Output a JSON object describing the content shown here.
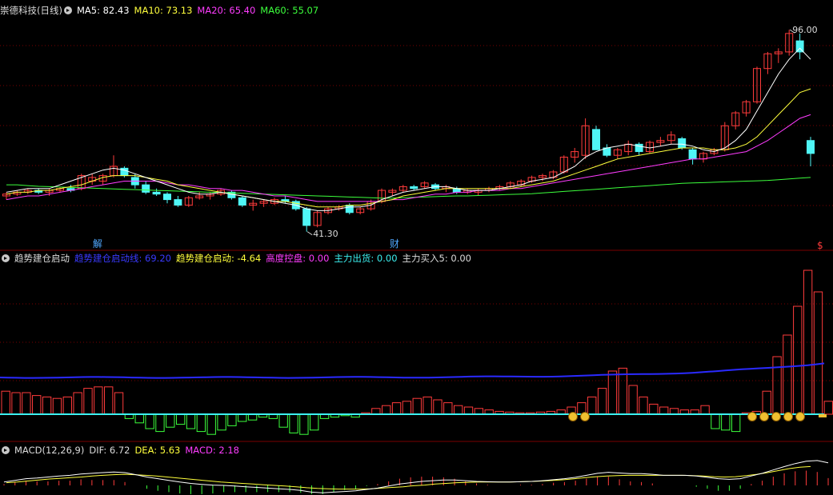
{
  "colors": {
    "bg": "#000000",
    "up": "#ff3b3b",
    "down": "#4ff6f6",
    "grid": "#7a0000",
    "ma5": "#ffffff",
    "ma10": "#ffff3c",
    "ma20": "#ff3cff",
    "ma60": "#3cff3c",
    "blue": "#2a2aff",
    "gold": "#f0c030"
  },
  "main": {
    "stock_name": "崇德科技",
    "period": "(日线)",
    "ma5": "MA5: 82.43",
    "ma10": "MA10: 73.13",
    "ma20": "MA20: 65.40",
    "ma60": "MA60: 55.07",
    "high_label": "96.00",
    "low_label": "41.30",
    "marker_jie": "解",
    "marker_cai": "财",
    "marker_dollar": "$"
  },
  "indicator": {
    "name": "趋势建仓启动",
    "line1": "趋势建仓启动线: 69.20",
    "line2": "趋势建仓启动: -4.64",
    "line3": "高度控盘: 0.00",
    "line4": "主力出货: 0.00",
    "line5": "主力买入5: 0.00"
  },
  "macd": {
    "name": "MACD(12,26,9)",
    "dif": "DIF: 6.72",
    "dea": "DEA: 5.63",
    "macd": "MACD: 2.18"
  },
  "chart_data": [
    {
      "type": "candlestick",
      "candles": [
        [
          0,
          51,
          52,
          50,
          51.5
        ],
        [
          1,
          51.5,
          52.5,
          51,
          52
        ],
        [
          2,
          52,
          53,
          51.5,
          52.5
        ],
        [
          3,
          52.5,
          53,
          51.5,
          52
        ],
        [
          4,
          52,
          53,
          51,
          52.5
        ],
        [
          5,
          52.5,
          53.5,
          52,
          53
        ],
        [
          6,
          53,
          54,
          52,
          52.5
        ],
        [
          7,
          53,
          57,
          52.5,
          56.5
        ],
        [
          8,
          55,
          57,
          54,
          56
        ],
        [
          9,
          55,
          57,
          54,
          56.5
        ],
        [
          10,
          56.5,
          62,
          56,
          59
        ],
        [
          11,
          58.5,
          59,
          56,
          56.5
        ],
        [
          12,
          56,
          57,
          53,
          54
        ],
        [
          13,
          54,
          55,
          51.5,
          52
        ],
        [
          14,
          52,
          53,
          51,
          51.5
        ],
        [
          15,
          51.5,
          52,
          49,
          50
        ],
        [
          16,
          50,
          51,
          48,
          48.5
        ],
        [
          17,
          48.5,
          51,
          48,
          50.5
        ],
        [
          18,
          50.5,
          52,
          50,
          51
        ],
        [
          19,
          51,
          52,
          50,
          51.5
        ],
        [
          20,
          51.5,
          53,
          51,
          52.5
        ],
        [
          21,
          52,
          52.5,
          50,
          50.5
        ],
        [
          22,
          50.5,
          51,
          48,
          48.5
        ],
        [
          23,
          48.5,
          50,
          47,
          49
        ],
        [
          24,
          49,
          50,
          48,
          49.5
        ],
        [
          25,
          49,
          50.5,
          48.5,
          50
        ],
        [
          26,
          50,
          51,
          49,
          49.5
        ],
        [
          27,
          49.5,
          50,
          47,
          47.5
        ],
        [
          28,
          47.5,
          48,
          41.3,
          43
        ],
        [
          29,
          43,
          47,
          42.5,
          46.5
        ],
        [
          30,
          46.5,
          48,
          46,
          47.5
        ],
        [
          31,
          47.5,
          48.5,
          47,
          48
        ],
        [
          32,
          48.5,
          49,
          46,
          46.5
        ],
        [
          33,
          46.5,
          48,
          46,
          47.5
        ],
        [
          34,
          47.5,
          50,
          47,
          49.5
        ],
        [
          35,
          49.5,
          53,
          49,
          52.5
        ],
        [
          36,
          52,
          53,
          51,
          52.5
        ],
        [
          37,
          52.5,
          54,
          52,
          53.5
        ],
        [
          38,
          53.5,
          54,
          52.5,
          53
        ],
        [
          39,
          53.5,
          55,
          53,
          54.5
        ],
        [
          40,
          54,
          54.5,
          52.5,
          53
        ],
        [
          41,
          53,
          54,
          52,
          53.5
        ],
        [
          42,
          53,
          53.5,
          51.5,
          52
        ],
        [
          43,
          52,
          53,
          51.5,
          52.5
        ],
        [
          44,
          52,
          53,
          51,
          52.5
        ],
        [
          45,
          52.5,
          53.5,
          52,
          53
        ],
        [
          46,
          53,
          54,
          52.5,
          53.5
        ],
        [
          47,
          53.5,
          55,
          53,
          54.5
        ],
        [
          48,
          54,
          55.5,
          53.5,
          55
        ],
        [
          49,
          55,
          56.5,
          54.5,
          56
        ],
        [
          50,
          56,
          57,
          55,
          56.5
        ],
        [
          51,
          56,
          58,
          55.5,
          57.5
        ],
        [
          52,
          57.5,
          62,
          57,
          61.5
        ],
        [
          53,
          61.5,
          64,
          60,
          63
        ],
        [
          54,
          62,
          72,
          61,
          70
        ],
        [
          55,
          69,
          70,
          64,
          63.5
        ],
        [
          56,
          64,
          65,
          61.5,
          62
        ],
        [
          57,
          62,
          64,
          61,
          63.5
        ],
        [
          58,
          63,
          66,
          62,
          65
        ],
        [
          59,
          65,
          65.5,
          62,
          63
        ],
        [
          60,
          63,
          66,
          62.5,
          65.5
        ],
        [
          61,
          65.5,
          67,
          64.5,
          66
        ],
        [
          62,
          66,
          68.5,
          65,
          67.5
        ],
        [
          63,
          66.5,
          67,
          63.5,
          64
        ],
        [
          64,
          63.5,
          64,
          59.5,
          61
        ],
        [
          65,
          61,
          63,
          60,
          62.5
        ],
        [
          66,
          62.5,
          64,
          62,
          63.5
        ],
        [
          67,
          63.5,
          71,
          63,
          70
        ],
        [
          68,
          70,
          74,
          69,
          73.5
        ],
        [
          69,
          73.5,
          77,
          72.5,
          76.5
        ],
        [
          70,
          76.5,
          86,
          76,
          85.5
        ],
        [
          71,
          85.5,
          90,
          84,
          89.5
        ],
        [
          72,
          89.5,
          91,
          87,
          90
        ],
        [
          73,
          90,
          96,
          89,
          95
        ],
        [
          74,
          93,
          95,
          88,
          90
        ],
        [
          75,
          66,
          67,
          59,
          62.5
        ]
      ],
      "ma5": [
        52,
        52.5,
        53,
        53,
        53,
        54,
        55,
        56,
        57,
        58,
        58.5,
        58,
        57,
        56,
        55,
        54,
        53,
        52,
        51.5,
        51.5,
        52,
        51.5,
        51,
        50.5,
        50,
        49.5,
        49,
        48.5,
        47.5,
        47,
        47,
        47.5,
        48,
        48,
        48.5,
        50,
        51,
        52,
        52.5,
        53,
        53.5,
        53.5,
        53,
        52.5,
        52.5,
        52.5,
        53,
        53.5,
        54,
        55,
        55.5,
        56,
        57.5,
        59,
        61.5,
        63,
        64,
        64.5,
        65,
        64.5,
        64,
        64.5,
        65,
        65,
        64.5,
        63.5,
        63,
        64,
        66,
        69,
        74,
        79,
        84,
        88,
        91,
        88
      ],
      "ma10": [
        51.5,
        52,
        52,
        52.5,
        52.5,
        53,
        53.5,
        54,
        55,
        56,
        56.5,
        56.5,
        56.5,
        56,
        55.5,
        55,
        54,
        53.5,
        53,
        52.5,
        52,
        51.5,
        51,
        50.5,
        50,
        49.5,
        49.5,
        49,
        48.5,
        48,
        48,
        48,
        48.5,
        48.5,
        49,
        49.5,
        50,
        51,
        51.5,
        52,
        52.5,
        53,
        53,
        53,
        53,
        53,
        53,
        53,
        53.5,
        54,
        54.5,
        55,
        56,
        57,
        58,
        59,
        60,
        61,
        61.5,
        62,
        62.5,
        63,
        63.5,
        64,
        64,
        64,
        63.5,
        63.5,
        64,
        65,
        67,
        70,
        73,
        76,
        79,
        80
      ],
      "ma20": [
        50,
        50.5,
        51,
        51,
        51.5,
        52,
        52.5,
        53,
        53.5,
        54,
        54.5,
        55,
        55,
        55,
        55,
        54.5,
        54,
        54,
        53.5,
        53,
        53,
        52.5,
        52.5,
        52,
        51.5,
        51,
        51,
        50.5,
        50,
        49.5,
        49.5,
        49.5,
        49.5,
        49.5,
        49.5,
        49.5,
        50,
        50,
        50.5,
        51,
        51.5,
        51.5,
        52,
        52,
        52.5,
        52.5,
        52.5,
        53,
        53,
        53.5,
        54,
        54.5,
        55,
        55.5,
        56,
        56.5,
        57,
        57.5,
        58,
        58.5,
        59,
        59.5,
        60,
        60.5,
        61,
        61,
        61.5,
        62,
        62.5,
        63,
        64.5,
        66,
        68,
        70,
        72,
        73
      ],
      "ma60": [
        54,
        54,
        53.8,
        53.6,
        53.5,
        53.4,
        53.3,
        53.2,
        53.1,
        53,
        52.9,
        52.8,
        52.7,
        52.6,
        52.5,
        52.4,
        52.3,
        52.2,
        52.1,
        52,
        51.9,
        51.8,
        51.7,
        51.6,
        51.5,
        51.4,
        51.3,
        51.2,
        51.1,
        51,
        50.9,
        50.8,
        50.7,
        50.6,
        50.5,
        50.4,
        50.4,
        50.5,
        50.6,
        50.7,
        50.8,
        50.9,
        51,
        51,
        51.1,
        51.2,
        51.3,
        51.4,
        51.5,
        51.6,
        51.8,
        52,
        52.2,
        52.4,
        52.6,
        52.8,
        53,
        53.2,
        53.4,
        53.6,
        53.8,
        54,
        54.2,
        54.4,
        54.5,
        54.6,
        54.7,
        54.8,
        54.9,
        55,
        55.1,
        55.2,
        55.4,
        55.6,
        55.8,
        56
      ]
    },
    {
      "type": "bar",
      "values": [
        32,
        30,
        30,
        26,
        24,
        22,
        24,
        30,
        36,
        38,
        38,
        30,
        -6,
        -12,
        -20,
        -24,
        -18,
        -14,
        -20,
        -24,
        -28,
        -22,
        -16,
        -10,
        -8,
        -4,
        -6,
        -18,
        -26,
        -28,
        -22,
        -6,
        -4,
        -2,
        -4,
        2,
        8,
        12,
        16,
        18,
        22,
        24,
        20,
        16,
        12,
        10,
        8,
        6,
        4,
        3,
        2,
        2,
        3,
        4,
        6,
        10,
        16,
        24,
        36,
        60,
        64,
        40,
        24,
        14,
        10,
        8,
        6,
        6,
        12,
        -20,
        -22,
        -24,
        2,
        4,
        32,
        80,
        110,
        150,
        200,
        170,
        18
      ]
    },
    {
      "type": "line",
      "dif": [
        1,
        1.5,
        2,
        2.2,
        2.5,
        2.8,
        3,
        3.4,
        3.6,
        3.8,
        4,
        3.8,
        3.2,
        2.5,
        2,
        1.5,
        1,
        0.6,
        0.3,
        0.1,
        0,
        -0.2,
        -0.4,
        -0.6,
        -0.8,
        -1,
        -1.2,
        -1.5,
        -2,
        -2.2,
        -2,
        -1.8,
        -1.6,
        -1.2,
        -0.8,
        -0.2,
        0.4,
        0.8,
        1.2,
        1.4,
        1.6,
        1.6,
        1.4,
        1.2,
        1.1,
        1,
        1,
        1.1,
        1.2,
        1.4,
        1.7,
        2,
        2.4,
        3,
        3.6,
        3.9,
        3.7,
        3.5,
        3.5,
        3.3,
        3,
        3,
        3,
        2.8,
        2.4,
        2,
        1.8,
        2,
        2.8,
        3.6,
        4.6,
        5.6,
        6.5,
        7.2,
        7.4,
        6.72
      ],
      "dea": [
        0.8,
        1,
        1.3,
        1.6,
        1.9,
        2.1,
        2.3,
        2.5,
        2.8,
        3,
        3.2,
        3.3,
        3.2,
        3,
        2.8,
        2.5,
        2.2,
        1.9,
        1.6,
        1.3,
        1,
        0.8,
        0.6,
        0.4,
        0.2,
        0,
        -0.2,
        -0.4,
        -0.7,
        -0.9,
        -1,
        -1.1,
        -1.1,
        -1.1,
        -1,
        -0.8,
        -0.6,
        -0.4,
        -0.1,
        0.1,
        0.4,
        0.6,
        0.8,
        0.9,
        1,
        1,
        1,
        1,
        1.1,
        1.2,
        1.3,
        1.5,
        1.7,
        2,
        2.3,
        2.6,
        2.8,
        2.9,
        3,
        3,
        3,
        3,
        3,
        3,
        2.9,
        2.8,
        2.6,
        2.5,
        2.6,
        2.9,
        3.3,
        3.8,
        4.4,
        5,
        5.4,
        5.63
      ]
    }
  ]
}
